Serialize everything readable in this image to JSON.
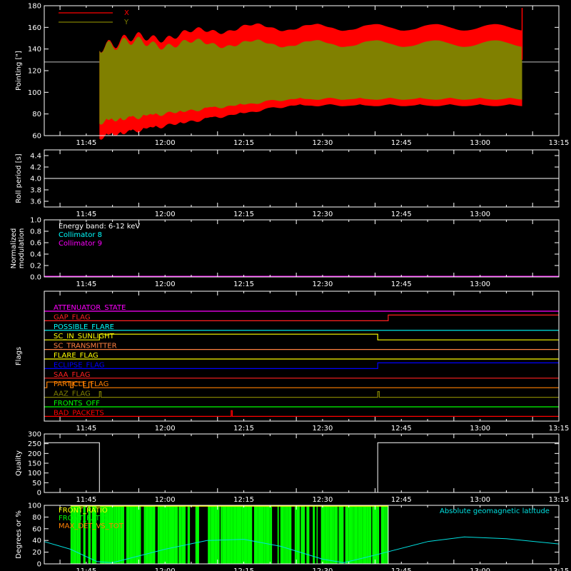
{
  "colors": {
    "background": "#000000",
    "axes": "#ffffff",
    "x_pointing": "#ff0000",
    "y_pointing": "#808000",
    "collimator8": "#00ffff",
    "collimator9": "#ff00ff",
    "front_ratio": "#ffff00",
    "front_ratio2": "#00ff00",
    "max_det": "#ff8000",
    "geomag": "#00e0e0"
  },
  "time_ticks": [
    "11:45",
    "12:00",
    "12:15",
    "12:30",
    "12:45",
    "13:00",
    "13:15"
  ],
  "chart_data": [
    {
      "id": "pointing",
      "type": "area",
      "ylabel": "Pointing [\"]",
      "yticks": [
        "60",
        "80",
        "100",
        "120",
        "140",
        "160",
        "180"
      ],
      "ylim": [
        60,
        180
      ],
      "xlim_minutes_since_1140": [
        -3,
        95
      ],
      "series": [
        {
          "name": "X",
          "color": "#ff0000",
          "t_start": 7.5,
          "t_end": 88.0,
          "upper_start": 145,
          "upper_end": 160,
          "lower_start": 65,
          "lower_end": 93
        },
        {
          "name": "Y",
          "color": "#808000",
          "t_start": 7.5,
          "t_end": 88.0,
          "upper_start": 145,
          "upper_end": 145,
          "lower_start": 75,
          "lower_end": 95
        }
      ],
      "reference_line": 128,
      "spike_at": 88.0
    },
    {
      "id": "roll",
      "type": "line",
      "ylabel": "Roll period [s]",
      "yticks": [
        "3.6",
        "3.8",
        "4.0",
        "4.2",
        "4.4"
      ],
      "ylim": [
        3.5,
        4.5
      ],
      "values": [
        4.0
      ]
    },
    {
      "id": "modulation",
      "type": "line",
      "ylabel_lines": [
        "Normalized",
        "modulation"
      ],
      "yticks": [
        "0.0",
        "0.2",
        "0.4",
        "0.6",
        "0.8",
        "1.0"
      ],
      "ylim": [
        0,
        1
      ],
      "legend": [
        {
          "name": "Energy band: 6-12 keV",
          "color": "#ffffff"
        },
        {
          "name": "Collimator 8",
          "color": "#00ffff"
        },
        {
          "name": "Collimator 9",
          "color": "#ff00ff"
        }
      ],
      "values": [
        0.0
      ]
    },
    {
      "id": "flags",
      "type": "line",
      "ylabel": "Flags",
      "series": [
        {
          "name": "ATTENUATOR_STATE",
          "color": "#ff00ff",
          "steps": []
        },
        {
          "name": "GAP_FLAG",
          "color": "#ff2020",
          "steps": [
            [
              62.5,
              1
            ]
          ]
        },
        {
          "name": "POSSIBLE_FLARE",
          "color": "#00ffff",
          "steps": []
        },
        {
          "name": "SC_IN_SUNLIGHT",
          "color": "#ffff00",
          "steps": [
            [
              7.5,
              1
            ],
            [
              60.5,
              0
            ]
          ]
        },
        {
          "name": "SC_TRANSMITTER",
          "color": "#ff8040",
          "steps": []
        },
        {
          "name": "FLARE_FLAG",
          "color": "#ffff00",
          "steps": []
        },
        {
          "name": "ECLIPSE_FLAG",
          "color": "#0000ff",
          "steps": [
            [
              7.5,
              0
            ],
            [
              60.5,
              1
            ]
          ]
        },
        {
          "name": "SAA_FLAG",
          "color": "#ff2020",
          "steps": []
        },
        {
          "name": "PARTICLE_FLAG",
          "color": "#ff8000",
          "steps": [
            [
              -2.5,
              1
            ],
            [
              2.0,
              0
            ],
            [
              2.5,
              1
            ],
            [
              4.5,
              0
            ],
            [
              5.5,
              1
            ],
            [
              6.0,
              0
            ]
          ]
        },
        {
          "name": "AAZ_FLAG",
          "color": "#808000",
          "steps": [
            [
              7.5,
              1
            ],
            [
              7.8,
              0
            ],
            [
              60.5,
              1
            ],
            [
              60.8,
              0
            ]
          ]
        },
        {
          "name": "FRONTS_OFF",
          "color": "#00ff00",
          "steps": []
        },
        {
          "name": "BAD_PACKETS",
          "color": "#ff0000",
          "steps": [
            [
              32.6,
              1
            ],
            [
              32.8,
              0
            ]
          ]
        }
      ]
    },
    {
      "id": "quality",
      "type": "line",
      "ylabel": "Quality",
      "yticks": [
        "0",
        "50",
        "100",
        "150",
        "200",
        "250",
        "300"
      ],
      "ylim": [
        0,
        300
      ],
      "points": [
        [
          -3,
          255
        ],
        [
          7.5,
          255
        ],
        [
          7.5,
          0
        ],
        [
          60.5,
          0
        ],
        [
          60.5,
          255
        ],
        [
          95,
          255
        ]
      ]
    },
    {
      "id": "ratios",
      "type": "area",
      "ylabel": "Degrees or %",
      "yticks": [
        "0",
        "20",
        "40",
        "60",
        "80",
        "100"
      ],
      "ylim": [
        0,
        100
      ],
      "legend": [
        {
          "name": "FRONT_RATIO",
          "color": "#ffff00"
        },
        {
          "name": "FRONT_RATIO_",
          "color": "#00ff00"
        },
        {
          "name": "MAX_DET_VS_TOT",
          "color": "#ff8000"
        }
      ],
      "geomag_label": "Absolute geomagnetic latitude",
      "front_ratio_interval": [
        2.0,
        62.5
      ],
      "geomag": [
        [
          -3,
          38
        ],
        [
          2,
          25
        ],
        [
          7,
          4
        ],
        [
          10,
          2
        ],
        [
          20,
          25
        ],
        [
          28,
          40
        ],
        [
          35,
          42
        ],
        [
          42,
          30
        ],
        [
          50,
          8
        ],
        [
          54,
          2
        ],
        [
          60,
          15
        ],
        [
          70,
          38
        ],
        [
          77,
          46
        ],
        [
          85,
          43
        ],
        [
          95,
          34
        ]
      ]
    }
  ]
}
